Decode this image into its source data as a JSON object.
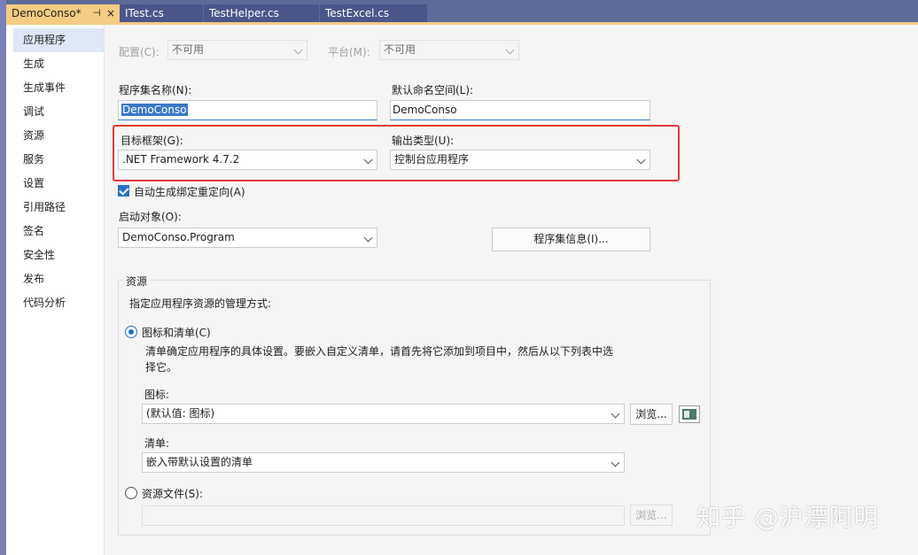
{
  "tabs": [
    {
      "label": "DemoConso*",
      "pin": "⊣",
      "close": "×",
      "active": true
    },
    {
      "label": "ITest.cs",
      "active": false
    },
    {
      "label": "TestHelper.cs",
      "active": false
    },
    {
      "label": "TestExcel.cs",
      "active": false
    }
  ],
  "nav": {
    "items": [
      "应用程序",
      "生成",
      "生成事件",
      "调试",
      "资源",
      "服务",
      "设置",
      "引用路径",
      "签名",
      "安全性",
      "发布",
      "代码分析"
    ],
    "selected": "应用程序"
  },
  "config": {
    "label": "配置(C):",
    "value": "不可用",
    "platform_label": "平台(M):",
    "platform_value": "不可用"
  },
  "assembly": {
    "name_label": "程序集名称(N):",
    "name_value": "DemoConso",
    "namespace_label": "默认命名空间(L):",
    "namespace_value": "DemoConso"
  },
  "framework": {
    "label": "目标框架(G):",
    "value": ".NET Framework 4.7.2",
    "output_label": "输出类型(U):",
    "output_value": "控制台应用程序"
  },
  "auto_redirect": {
    "label": "自动生成绑定重定向(A)",
    "checked": true
  },
  "startup": {
    "label": "启动对象(O):",
    "value": "DemoConso.Program",
    "assembly_info_button": "程序集信息(I)..."
  },
  "resources": {
    "group_title": "资源",
    "instruction": "指定应用程序资源的管理方式:",
    "icon_manifest_option": "图标和清单(C)",
    "description_line1": "清单确定应用程序的具体设置。要嵌入自定义清单，请首先将它添加到项目中，然后从以下列表中选",
    "description_line2": "择它。",
    "icon_label": "图标:",
    "icon_value": "(默认值: 图标)",
    "browse_label": "浏览...",
    "manifest_label": "清单:",
    "manifest_value": "嵌入带默认设置的清单",
    "resource_file_option": "资源文件(S):",
    "resource_file_value": "",
    "resource_browse_label": "浏览..."
  },
  "watermark": "知乎 @沪漂阿明",
  "colors": {
    "tab_active": "#f5cc84",
    "tabstrip": "#5d6b99",
    "highlight_box": "#e33a3a",
    "accent": "#2a6fc4"
  }
}
